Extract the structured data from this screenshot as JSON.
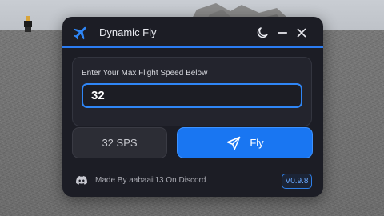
{
  "window": {
    "title": "Dynamic Fly",
    "icons": [
      "plane-icon",
      "moon-icon",
      "minimize-icon",
      "close-icon"
    ]
  },
  "speed": {
    "label": "Enter Your Max Flight Speed Below",
    "value": "32"
  },
  "buttons": {
    "sps_label": "32 SPS",
    "fly_label": "Fly"
  },
  "footer": {
    "credit": "Made By aabaaii13 On Discord",
    "version": "V0.9.8"
  },
  "colors": {
    "accent": "#1976f2",
    "panel_bg": "#1c1d25",
    "card_bg": "#23242d"
  }
}
